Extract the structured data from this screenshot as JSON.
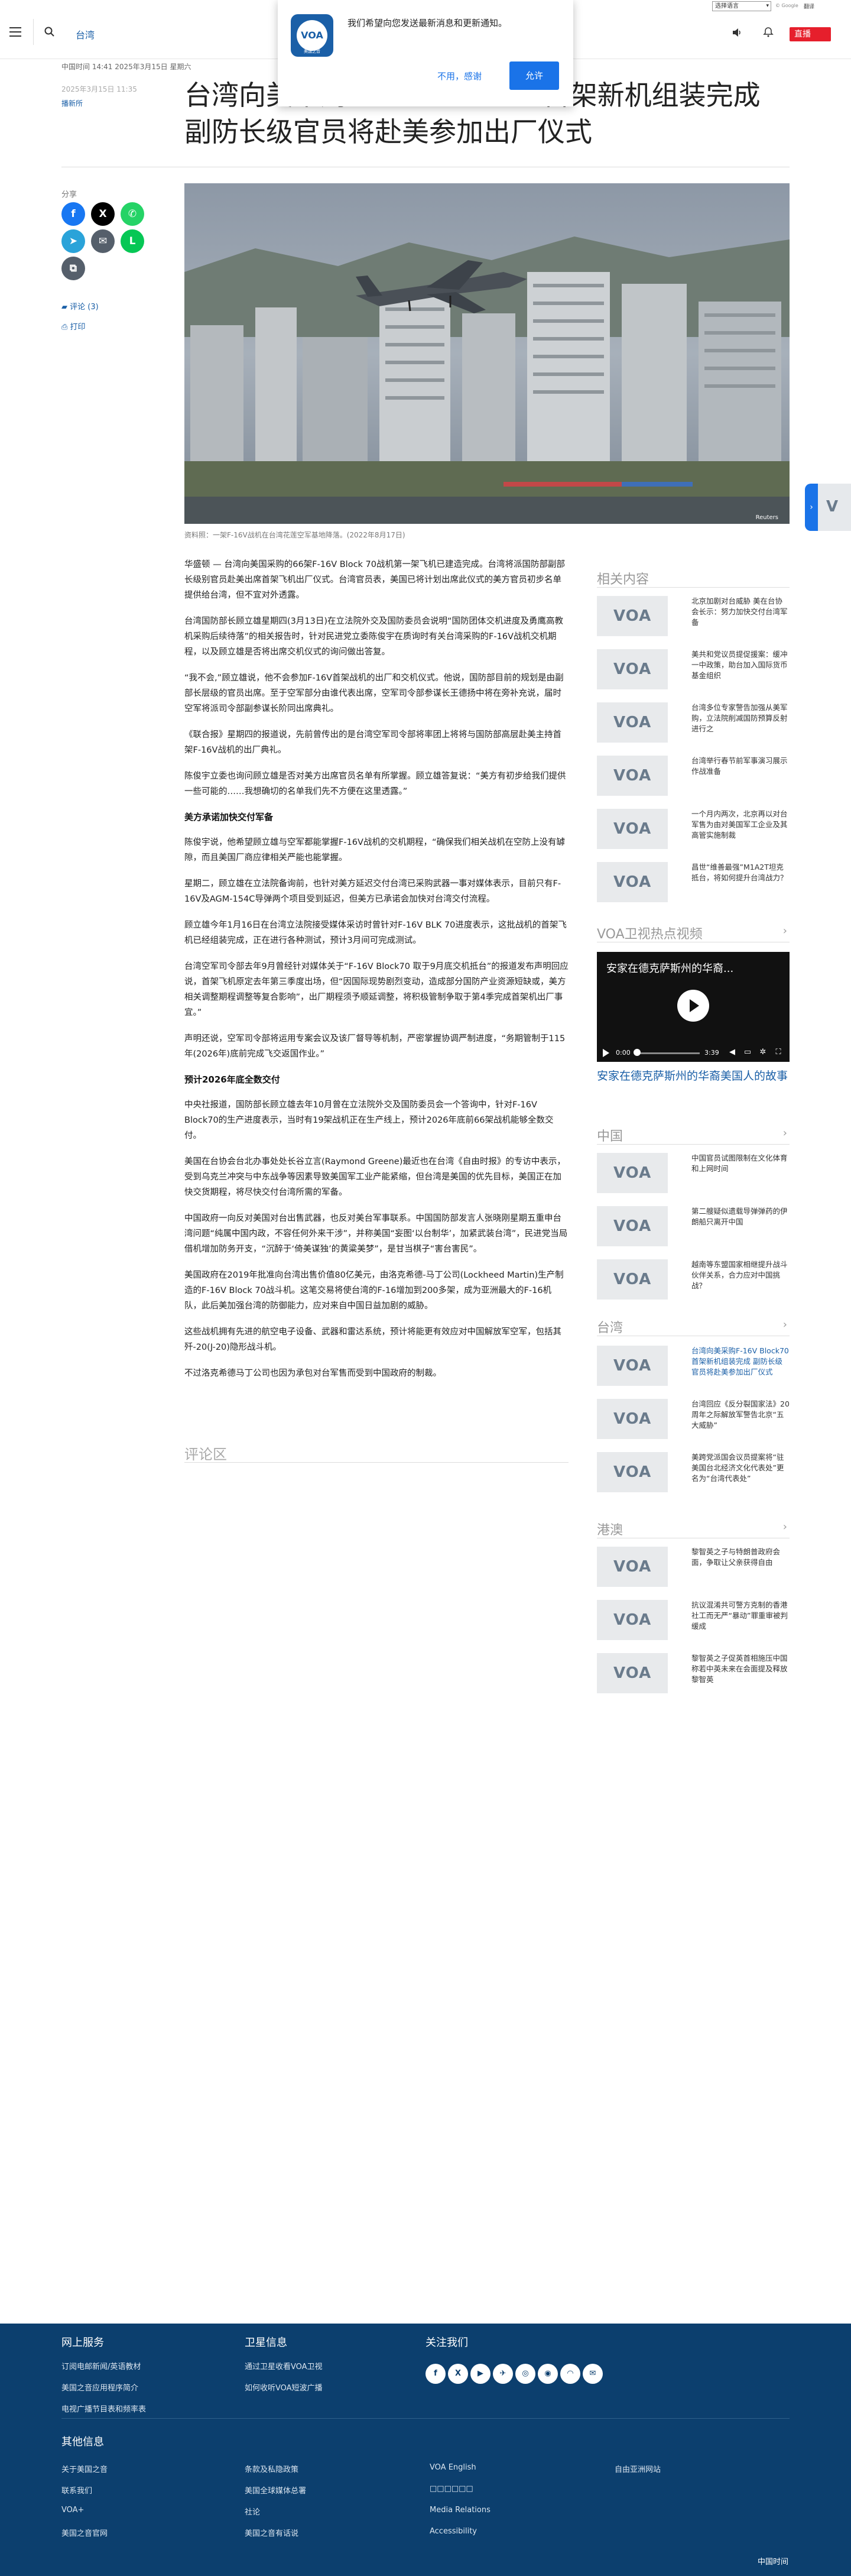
{
  "top_strip": {
    "language_select": "选择语言",
    "google_tag": "© Google",
    "translate_tag": "翻译"
  },
  "header": {
    "section": "台湾",
    "live_button": "直播",
    "icons": [
      "menu-icon",
      "search-icon",
      "speaker-icon",
      "bell-icon"
    ]
  },
  "notification": {
    "logo_text": "VOA",
    "logo_sub": "美国之音",
    "message": "我们希望向您发送最新消息和更新通知。",
    "decline": "不用，感谢",
    "allow": "允许"
  },
  "article_meta": {
    "dateline": "中国时间 14:41 2025年3月15日 星期六",
    "date2": "2025年3月15日 11:35",
    "author": "播新所"
  },
  "article": {
    "title": "台湾向美采购F-16V Block70首架新机组装完成 副防长级官员将赴美参加出厂仪式",
    "photo_caption": "资料照：一架F-16V战机在台湾花莲空军基地降落。(2022年8月17日)",
    "photo_credit": "Reuters",
    "paragraphs": [
      "华盛顿 — 台湾向美国采购的66架F-16V Block 70战机第一架飞机已建造完成。台湾将派国防部副部长级别官员赴美出席首架飞机出厂仪式。台湾官员表，美国已将计划出席此仪式的美方官员初步名单提供给台湾，但不宜对外透露。",
      "台湾国防部长顾立雄星期四(3月13日)在立法院外交及国防委员会说明“国防团体交机进度及勇鹰高教机采购后续待落”的相关报告时，针对民进党立委陈俊宇在质询时有关台湾采购的F-16V战机交机期程，以及顾立雄是否将出席交机仪式的询问做出答复。",
      "“我不会,”顾立雄说，他不会参加F-16V首架战机的出厂和交机仪式。他说，国防部目前的规划是由副部长层级的官员出席。至于空军部分由谁代表出席，空军司令部参谋长王德扬中将在旁补充说，届时空军将派司令部副参谋长阶同出席典礼。",
      "《联合报》星期四的报道说，先前曾传出的是台湾空军司令部将率团上将将与国防部高层赴美主持首架F-16V战机的出厂典礼。",
      "陈俊宇立委也询问顾立雄是否对美方出席官员名单有所掌握。顾立雄答复说：“美方有初步给我们提供一些可能的……我想确切的名单我们先不方便在这里透露。”",
      "陈俊宇说，他希望顾立雄与空军都能掌握F-16V战机的交机期程，“确保我们相关战机在空防上没有罅隙，而且美国厂商应律相关严能也能掌握。",
      "星期二，顾立雄在立法院备询前，也针对美方延迟交付台湾已采购武器一事对媒体表示，目前只有F-16V及AGM-154C导弹两个项目受到延迟，但美方已承诺会加快对台湾交付流程。",
      "顾立雄今年1月16日在台湾立法院接受媒体采访时曾针对F-16V BLK 70进度表示，这批战机的首架飞机已经组装完成，正在进行各种测试，预计3月间可完成测试。",
      "台湾空军司令部去年9月曾经针对媒体关于“F-16V Block70 取于9月底交机抵台”的报道发布声明回应说，首架飞机原定去年第三季度出场，但“因国际现势剧烈变动，造成部分国防产业资源短缺或，美方相关调整期程调整等复合影响”，出厂期程须予顺延调整，将积极管制争取于第4季完成首架机出厂事宜。”",
      "声明还说，空军司令部将运用专案会议及该厂督导等机制，严密掌握协调严制进度，“务期管制于115年(2026年)底前完成飞交返国作业。”",
      "中央社报道，国防部长顾立雄去年10月曾在立法院外交及国防委员会一个答询中，针对F-16V Block70的生产进度表示，当时有19架战机正在生产线上，预计2026年底前66架战机能够全数交付。",
      "美国在台协会台北办事处处长谷立言(Raymond Greene)最近也在台湾《自由时报》的专访中表示，受到乌克兰冲突与中东战争等因素导致美国军工业产能紧缩，但台湾是美国的优先目标，美国正在加快交货期程，将尽快交付台湾所需的军备。",
      "中国政府一向反对美国对台出售武器，也反对美台军事联系。中国国防部发言人张晓刚星期五重申台湾问题“纯属中国内政，不容任何外来干涉”，并称美国“妄图‘以台制华’，加紧武装台湾”，民进党当局借机增加防务开支，“沉醉于‘倚美谋独’的黄粱美梦”，是甘当棋子“害台害民”。",
      "美国政府在2019年批准向台湾出售价值80亿美元，由洛克希德-马丁公司(Lockheed Martin)生产制造的F-16V Block 70战斗机。这笔交易将使台湾的F-16增加到200多架，成为亚洲最大的F-16机队，此后美加强台湾的防御能力，应对来自中国日益加剧的威胁。",
      "这些战机拥有先进的航空电子设备、武器和雷达系统，预计将能更有效应对中国解放军空军，包括其歼-20(J-20)隐形战斗机。",
      "不过洛克希德马丁公司也因为承包对台军售而受到中国政府的制裁。"
    ],
    "subheads": [
      "美方承诺加快交付军备",
      "预计2026年底全数交付"
    ],
    "comments_heading": "评论区"
  },
  "share": {
    "label": "分享",
    "comments_link": "评论 (3)",
    "print_link": "打印",
    "buttons": [
      {
        "name": "facebook-share-button",
        "glyph": "f",
        "color": "#1877f2"
      },
      {
        "name": "x-share-button",
        "glyph": "X",
        "color": "#000000"
      },
      {
        "name": "whatsapp-share-button",
        "glyph": "✆",
        "color": "#25d366"
      },
      {
        "name": "telegram-share-button",
        "glyph": "➤",
        "color": "#2aa3d9"
      },
      {
        "name": "email-share-button",
        "glyph": "✉",
        "color": "#555f6b"
      },
      {
        "name": "line-share-button",
        "glyph": "L",
        "color": "#06c755"
      },
      {
        "name": "copy-link-button",
        "glyph": "⧉",
        "color": "#555f6b"
      }
    ]
  },
  "sidebar": {
    "related": {
      "heading": "相关内容",
      "items": [
        "北京加剧对台威胁 美在台协会长示：努力加快交付台湾军备",
        "美共和党议员提促援案：缓冲一中政策，助台加入国际货币基金组织",
        "台湾多位专家警告加强从美军购，立法院削减国防预算反射进行之",
        "台湾举行春节前军事演习展示作战准备",
        "一个月内两次，北京再以对台军售为由对美国军工企业及其高管实施制裁",
        "昌世“维善最强”M1A2T坦克抵台，将如何提升台湾战力？"
      ]
    },
    "video": {
      "heading": "VOA卫视热点视频",
      "title": "安家在德克萨斯州的华裔...",
      "time_start": "0:00",
      "time_end": "3:39",
      "caption": "安家在德克萨斯州的华裔美国人的故事"
    },
    "china": {
      "heading": "中国",
      "items": [
        "中国官员试图限制在文化体育和上网时间",
        "第二艘疑似遗载导弹弹药的伊朗船只离开中国",
        "越南等东盟国家相继提升战斗伙伴关系，合力应对中国挑战？"
      ]
    },
    "taiwan": {
      "heading": "台湾",
      "items": [
        "台湾向美采购F-16V Block70首架新机组装完成 副防长级官员将赴美参加出厂仪式",
        "台湾回应《反分裂国家法》20周年之际解放军警告北京“五大威胁”",
        "美跨党派国会议员提案将“驻美国台北经济文化代表处”更名为“台湾代表处”"
      ]
    },
    "hongkong": {
      "heading": "港澳",
      "items": [
        "黎智英之子与特朗普政府会面，争取让父亲获得自由",
        "抗议混淆共可警方克制的香港社工而无严“暴动”罪重审被判缓成",
        "黎智英之子促英首相施压中国 称若中英未来在会面提及释放黎智英"
      ]
    }
  },
  "footer": {
    "col1_heading": "网上服务",
    "col1_links": [
      "订阅电邮新闻/英语教材",
      "美国之音应用程序简介",
      "电视广播节目表和频率表"
    ],
    "col2_heading": "卫星信息",
    "col2_links": [
      "通过卫星收看VOA卫视",
      "如何收听VOA短波广播"
    ],
    "col3_heading": "关注我们",
    "social": [
      "facebook-icon",
      "x-icon",
      "youtube-icon",
      "telegram-icon",
      "instagram-icon",
      "podcast-icon",
      "rss-icon",
      "email-icon"
    ],
    "other_heading": "其他信息",
    "other_links": [
      [
        "关于美国之音",
        "条款及私隐政策",
        "VOA English",
        "自由亚洲网站"
      ],
      [
        "联系我们",
        "美国全球媒体总署",
        "□□□□□□",
        ""
      ],
      [
        "VOA+",
        "社论",
        "Media Relations",
        ""
      ],
      [
        "美国之音官网",
        "美国之音有话说",
        "Accessibility",
        ""
      ]
    ],
    "copyright": "中国时间"
  }
}
